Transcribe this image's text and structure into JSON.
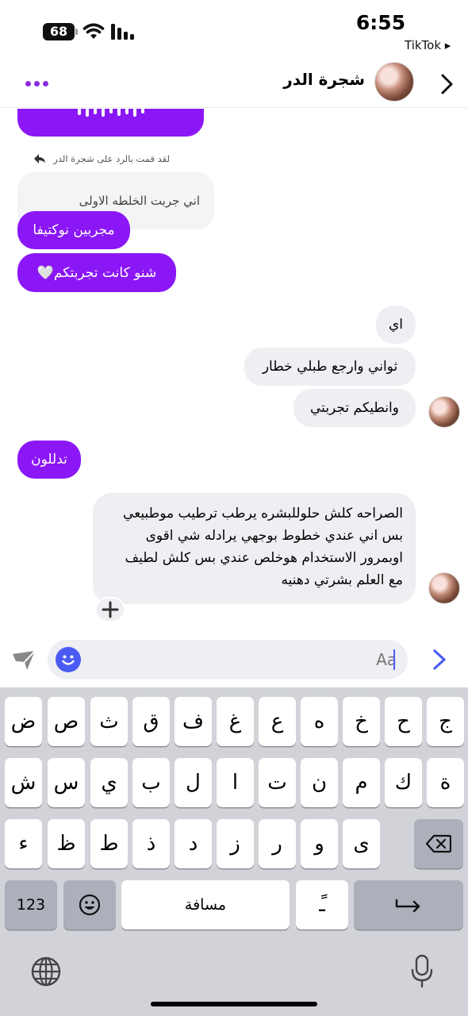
{
  "status_bar": {
    "battery": "68",
    "time": "6:55",
    "back_app": "TikTok ▸"
  },
  "header": {
    "contact_name": "شجرة الدر"
  },
  "chat": {
    "reply_note": "لقد قمت بالرد على شجرة الدر",
    "quoted_text": "اني جربت الخلطه الاولى",
    "messages": [
      {
        "side": "outgoing",
        "text": "مجربين نوكتيفا"
      },
      {
        "side": "outgoing",
        "text": "شنو كانت تجربتكم🤍"
      },
      {
        "side": "incoming",
        "text": "اي"
      },
      {
        "side": "incoming",
        "text": "ثواني وارجع طبلي خطار"
      },
      {
        "side": "incoming",
        "text": "وانطيكم تجربتي"
      },
      {
        "side": "outgoing",
        "text": "تدللون"
      },
      {
        "side": "incoming",
        "lines": [
          "الصراحه كلش حلوللبشره يرطب ترطيب موطبيعي",
          "بس اني عندي خطوط بوجهي يرادله شي اقوى",
          "اوبمرور الاستخدام هوخلص عندي بس كلش لطيف",
          "مع العلم بشرتي دهنيه"
        ]
      }
    ]
  },
  "composer": {
    "placeholder": "Aa"
  },
  "keyboard": {
    "row1": [
      "ض",
      "ص",
      "ث",
      "ق",
      "ف",
      "غ",
      "ع",
      "ه",
      "خ",
      "ح",
      "ج"
    ],
    "row2": [
      "ش",
      "س",
      "ي",
      "ب",
      "ل",
      "ا",
      "ت",
      "ن",
      "م",
      "ك",
      "ة"
    ],
    "row3": [
      "ء",
      "ظ",
      "ط",
      "ذ",
      "د",
      "ز",
      "ر",
      "و",
      "ى"
    ],
    "numbers_key": "123",
    "space_label": "مسافة",
    "diacritic_key": "ًـ"
  },
  "colors": {
    "accent_purple": "#8b17f7",
    "incoming_bubble": "#eeeff2",
    "messenger_blue": "#4a5bf3",
    "keyboard_bg": "#d1d3d9"
  }
}
